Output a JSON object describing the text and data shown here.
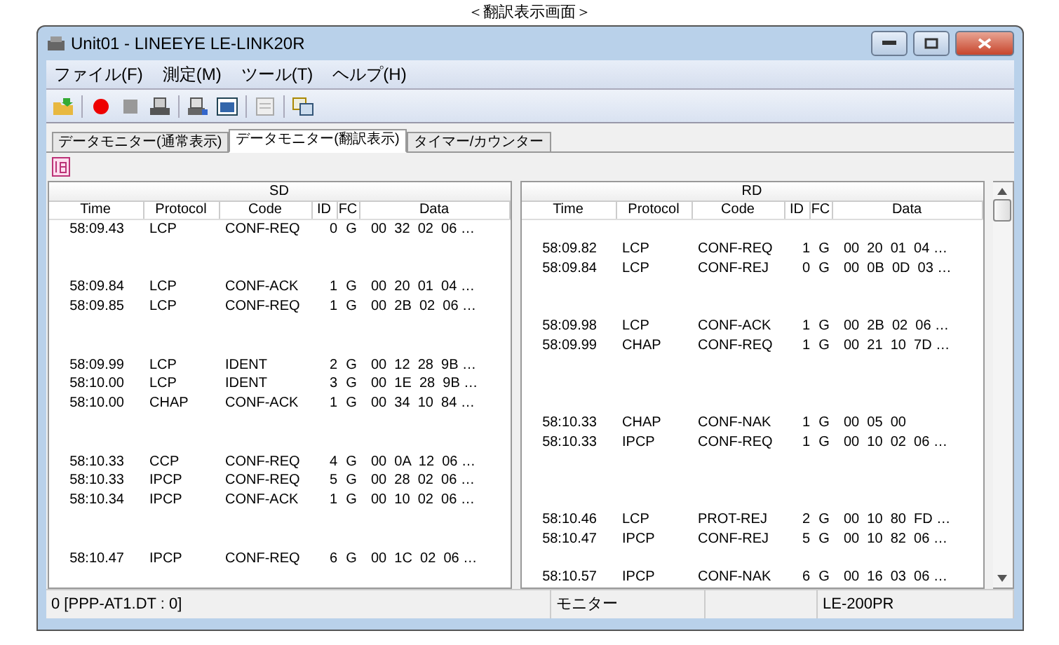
{
  "caption": "＜翻訳表示画面＞",
  "window": {
    "title": "Unit01 - LINEEYE LE-LINK20R"
  },
  "menu": [
    "ファイル(F)",
    "測定(M)",
    "ツール(T)",
    "ヘルプ(H)"
  ],
  "tabs": [
    {
      "label": "データモニター(通常表示)",
      "selected": false
    },
    {
      "label": "データモニター(翻訳表示)",
      "selected": true
    },
    {
      "label": "タイマー/カウンター",
      "selected": false
    }
  ],
  "panes": [
    {
      "title": "SD",
      "columns": [
        "Time",
        "Protocol",
        "Code",
        "ID",
        "FC",
        "Data"
      ],
      "rows": [
        {
          "kind": "entry",
          "time": "58:09.43",
          "protocol": "LCP",
          "code": "CONF-REQ",
          "id": "0",
          "fc": "G",
          "data": "00  32  02  06 …"
        },
        {
          "kind": "gap"
        },
        {
          "kind": "gap"
        },
        {
          "kind": "entry",
          "time": "58:09.84",
          "protocol": "LCP",
          "code": "CONF-ACK",
          "id": "1",
          "fc": "G",
          "data": "00  20  01  04 …"
        },
        {
          "kind": "entry",
          "time": "58:09.85",
          "protocol": "LCP",
          "code": "CONF-REQ",
          "id": "1",
          "fc": "G",
          "data": "00  2B  02  06 …"
        },
        {
          "kind": "gap"
        },
        {
          "kind": "gap"
        },
        {
          "kind": "entry",
          "time": "58:09.99",
          "protocol": "LCP",
          "code": "IDENT",
          "id": "2",
          "fc": "G",
          "data": "00  12  28  9B …"
        },
        {
          "kind": "entry",
          "time": "58:10.00",
          "protocol": "LCP",
          "code": "IDENT",
          "id": "3",
          "fc": "G",
          "data": "00  1E  28  9B …"
        },
        {
          "kind": "entry",
          "time": "58:10.00",
          "protocol": "CHAP",
          "code": "CONF-ACK",
          "id": "1",
          "fc": "G",
          "data": "00  34  10  84 …"
        },
        {
          "kind": "gap"
        },
        {
          "kind": "gap"
        },
        {
          "kind": "entry",
          "time": "58:10.33",
          "protocol": "CCP",
          "code": "CONF-REQ",
          "id": "4",
          "fc": "G",
          "data": "00  0A  12  06 …"
        },
        {
          "kind": "entry",
          "time": "58:10.33",
          "protocol": "IPCP",
          "code": "CONF-REQ",
          "id": "5",
          "fc": "G",
          "data": "00  28  02  06 …"
        },
        {
          "kind": "entry",
          "time": "58:10.34",
          "protocol": "IPCP",
          "code": "CONF-ACK",
          "id": "1",
          "fc": "G",
          "data": "00  10  02  06 …"
        },
        {
          "kind": "gap"
        },
        {
          "kind": "gap"
        },
        {
          "kind": "entry",
          "time": "58:10.47",
          "protocol": "IPCP",
          "code": "CONF-REQ",
          "id": "6",
          "fc": "G",
          "data": "00  1C  02  06 …"
        }
      ]
    },
    {
      "title": "RD",
      "columns": [
        "Time",
        "Protocol",
        "Code",
        "ID",
        "FC",
        "Data"
      ],
      "rows": [
        {
          "kind": "gap"
        },
        {
          "kind": "entry",
          "time": "58:09.82",
          "protocol": "LCP",
          "code": "CONF-REQ",
          "id": "1",
          "fc": "G",
          "data": "00  20  01  04 …"
        },
        {
          "kind": "entry",
          "time": "58:09.84",
          "protocol": "LCP",
          "code": "CONF-REJ",
          "id": "0",
          "fc": "G",
          "data": "00  0B  0D  03 …"
        },
        {
          "kind": "gap"
        },
        {
          "kind": "gap"
        },
        {
          "kind": "entry",
          "time": "58:09.98",
          "protocol": "LCP",
          "code": "CONF-ACK",
          "id": "1",
          "fc": "G",
          "data": "00  2B  02  06 …"
        },
        {
          "kind": "entry",
          "time": "58:09.99",
          "protocol": "CHAP",
          "code": "CONF-REQ",
          "id": "1",
          "fc": "G",
          "data": "00  21  10  7D …"
        },
        {
          "kind": "gap"
        },
        {
          "kind": "gap"
        },
        {
          "kind": "gap"
        },
        {
          "kind": "entry",
          "time": "58:10.33",
          "protocol": "CHAP",
          "code": "CONF-NAK",
          "id": "1",
          "fc": "G",
          "data": "00  05  00"
        },
        {
          "kind": "entry",
          "time": "58:10.33",
          "protocol": "IPCP",
          "code": "CONF-REQ",
          "id": "1",
          "fc": "G",
          "data": "00  10  02  06 …"
        },
        {
          "kind": "gap"
        },
        {
          "kind": "gap"
        },
        {
          "kind": "gap"
        },
        {
          "kind": "entry",
          "time": "58:10.46",
          "protocol": "LCP",
          "code": "PROT-REJ",
          "id": "2",
          "fc": "G",
          "data": "00  10  80  FD …"
        },
        {
          "kind": "entry",
          "time": "58:10.47",
          "protocol": "IPCP",
          "code": "CONF-REJ",
          "id": "5",
          "fc": "G",
          "data": "00  10  82  06 …"
        },
        {
          "kind": "gap"
        },
        {
          "kind": "entry",
          "time": "58:10.57",
          "protocol": "IPCP",
          "code": "CONF-NAK",
          "id": "6",
          "fc": "G",
          "data": "00  16  03  06 …"
        }
      ]
    }
  ],
  "status_bar": {
    "file": "0 [PPP-AT1.DT : 0]",
    "mode": "モニター",
    "device": "LE-200PR"
  }
}
